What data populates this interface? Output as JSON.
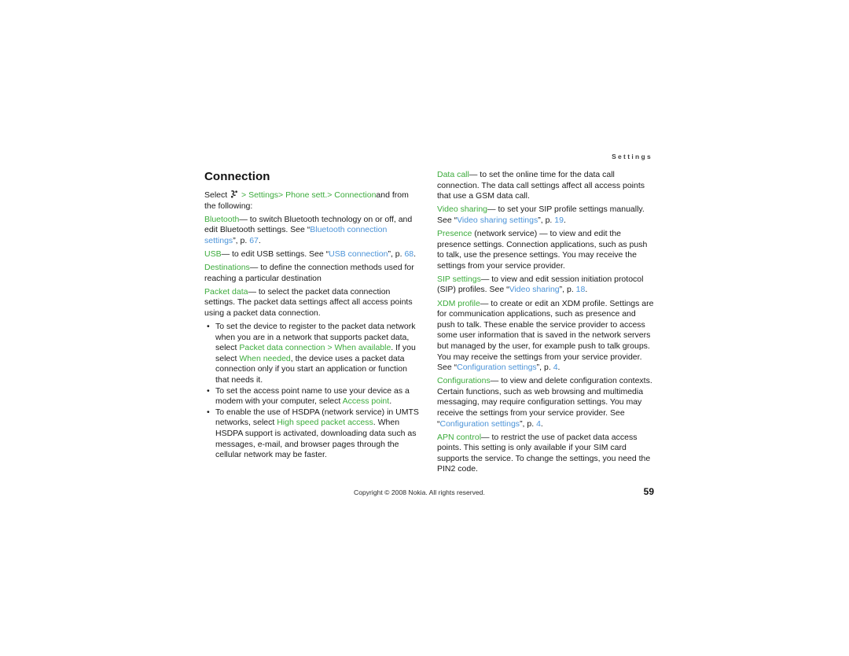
{
  "page": {
    "running_head": "Settings",
    "section_title": "Connection",
    "page_number": "59",
    "copyright": "Copyright © 2008 Nokia. All rights reserved."
  },
  "colors": {
    "menu_green": "#3cab3c",
    "link_blue": "#4b93d8",
    "body_text": "#1a1a1a"
  },
  "icons": {
    "menu_key": "menu-key-icon"
  },
  "left_column": {
    "intro": {
      "select_label": "Select",
      "path_sep_1": ">",
      "path_1": "Settings",
      "path_sep_2": ">",
      "path_2": "Phone sett.",
      "path_sep_3": ">",
      "path_3": "Connection",
      "tail": "and from the following:"
    },
    "entries": [
      {
        "term": "Bluetooth",
        "text_1": "— to switch Bluetooth technology on or off, and edit Bluetooth settings. See “",
        "link": "Bluetooth connection settings",
        "text_2": "”, p. ",
        "page_ref": "67",
        "text_3": "."
      },
      {
        "term": "USB",
        "text_1": "— to edit USB settings. See “",
        "link": "USB connection",
        "text_2": "”, p. ",
        "page_ref": "68",
        "text_3": "."
      },
      {
        "term": "Destinations",
        "text_1": "— to define the connection methods used for reaching a particular destination",
        "link": "",
        "text_2": "",
        "page_ref": "",
        "text_3": ""
      },
      {
        "term": "Packet data",
        "text_1": "— to select the packet data connection settings. The packet data settings affect all access points using a packet data connection.",
        "link": "",
        "text_2": "",
        "page_ref": "",
        "text_3": ""
      }
    ],
    "bullets": [
      {
        "text_1": "To set the device to register to the packet data network when you are in a network that supports packet data, select ",
        "menu_1": "Packet data connection",
        "sep_1": " > ",
        "menu_2": "When available",
        "text_2": ". If you select ",
        "menu_3": "When needed",
        "text_3": ", the device uses a packet data connection only if you start an application or function that needs it."
      },
      {
        "text_1": "To set the access point name to use your device as a modem with your computer, select ",
        "menu_1": "Access point",
        "sep_1": "",
        "menu_2": "",
        "text_2": ".",
        "menu_3": "",
        "text_3": ""
      },
      {
        "text_1": "To enable the use of HSDPA (network service) in UMTS networks, select ",
        "menu_1": "High speed packet access",
        "sep_1": "",
        "menu_2": "",
        "text_2": ". When HSDPA support is activated, downloading data such as messages, e-mail, and browser pages through the cellular network may be faster.",
        "menu_3": "",
        "text_3": ""
      }
    ]
  },
  "right_column": {
    "entries": [
      {
        "term": "Data call",
        "text_1": "— to set the online time for the data call connection. The data call settings affect all access points that use a GSM data call.",
        "link": "",
        "text_2": "",
        "page_ref": "",
        "text_3": ""
      },
      {
        "term": "Video sharing",
        "text_1": "— to set your SIP profile settings manually. See “",
        "link": "Video sharing settings",
        "text_2": "”, p. ",
        "page_ref": "19",
        "text_3": "."
      },
      {
        "term": "Presence",
        "text_1": " (network service) — to view and edit the presence settings. Connection applications, such as push to talk, use the presence settings. You may receive the settings from your service provider.",
        "link": "",
        "text_2": "",
        "page_ref": "",
        "text_3": ""
      },
      {
        "term": "SIP settings",
        "text_1": "— to view and edit session initiation protocol (SIP) profiles. See “",
        "link": "Video sharing",
        "text_2": "”, p. ",
        "page_ref": "18",
        "text_3": "."
      },
      {
        "term": "XDM profile",
        "text_1": "— to create or edit an XDM profile. Settings are for communication applications, such as presence and push to talk. These enable the service provider to access some user information that is saved in the network servers but managed by the user, for example push to talk groups. You may receive the settings from your service provider. See “",
        "link": "Configuration settings",
        "text_2": "”, p. ",
        "page_ref": "4",
        "text_3": "."
      },
      {
        "term": "Configurations",
        "text_1": "— to view and delete configuration contexts. Certain functions, such as web browsing and multimedia messaging, may require configuration settings. You may receive the settings from your service provider. See “",
        "link": "Configuration settings",
        "text_2": "”, p. ",
        "page_ref": "4",
        "text_3": "."
      },
      {
        "term": "APN control",
        "text_1": "— to restrict the use of packet data access points. This setting is only available if your SIM card supports the service. To change the settings, you need the PIN2 code.",
        "link": "",
        "text_2": "",
        "page_ref": "",
        "text_3": ""
      }
    ]
  }
}
